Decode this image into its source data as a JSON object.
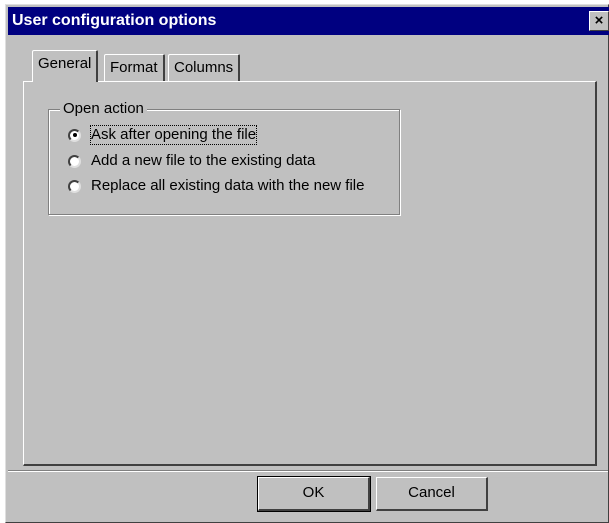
{
  "dialog": {
    "title": "User configuration options",
    "close_glyph": "×"
  },
  "tabs": [
    {
      "label": "General",
      "active": true
    },
    {
      "label": "Format",
      "active": false
    },
    {
      "label": "Columns",
      "active": false
    }
  ],
  "open_action": {
    "legend": "Open action",
    "options": [
      {
        "label": "Ask after opening the file",
        "selected": true
      },
      {
        "label": "Add a new file to the existing data",
        "selected": false
      },
      {
        "label": "Replace all existing data with the new file",
        "selected": false
      }
    ]
  },
  "buttons": {
    "ok": "OK",
    "cancel": "Cancel"
  },
  "colors": {
    "titlebar": "#000080",
    "dialog_face": "#c0c0c0"
  }
}
